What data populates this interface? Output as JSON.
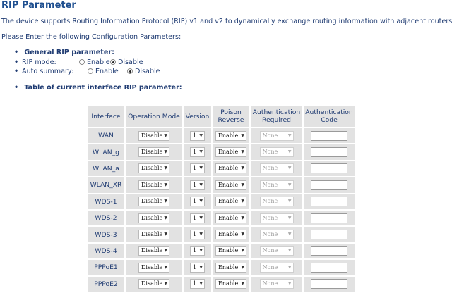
{
  "page": {
    "title": "RIP Parameter",
    "description": "The device supports Routing Information Protocol (RIP) v1 and v2 to dynamically exchange routing information with adjacent routers.",
    "instruction": "Please Enter the following Configuration Parameters:"
  },
  "general": {
    "heading": "General RIP parameter:",
    "rip_mode": {
      "label": "RIP mode:",
      "enable": "Enable",
      "disable": "Disable",
      "selected": "Disable"
    },
    "auto_summary": {
      "label": "Auto summary:",
      "enable": "Enable",
      "disable": "Disable",
      "selected": "Disable"
    }
  },
  "table_heading": "Table of current interface RIP parameter:",
  "table": {
    "headers": {
      "interface": "Interface",
      "operation_mode": "Operation Mode",
      "version": "Version",
      "poison_reverse_1": "Poison",
      "poison_reverse_2": "Reverse",
      "auth_required_1": "Authentication",
      "auth_required_2": "Required",
      "auth_code_1": "Authentication",
      "auth_code_2": "Code"
    },
    "rows": [
      {
        "interface": "WAN",
        "operation_mode": "Disable",
        "version": "1",
        "poison_reverse": "Enable",
        "auth_required": "None",
        "auth_code": ""
      },
      {
        "interface": "WLAN_g",
        "operation_mode": "Disable",
        "version": "1",
        "poison_reverse": "Enable",
        "auth_required": "None",
        "auth_code": ""
      },
      {
        "interface": "WLAN_a",
        "operation_mode": "Disable",
        "version": "1",
        "poison_reverse": "Enable",
        "auth_required": "None",
        "auth_code": ""
      },
      {
        "interface": "WLAN_XR",
        "operation_mode": "Disable",
        "version": "1",
        "poison_reverse": "Enable",
        "auth_required": "None",
        "auth_code": ""
      },
      {
        "interface": "WDS-1",
        "operation_mode": "Disable",
        "version": "1",
        "poison_reverse": "Enable",
        "auth_required": "None",
        "auth_code": ""
      },
      {
        "interface": "WDS-2",
        "operation_mode": "Disable",
        "version": "1",
        "poison_reverse": "Enable",
        "auth_required": "None",
        "auth_code": ""
      },
      {
        "interface": "WDS-3",
        "operation_mode": "Disable",
        "version": "1",
        "poison_reverse": "Enable",
        "auth_required": "None",
        "auth_code": ""
      },
      {
        "interface": "WDS-4",
        "operation_mode": "Disable",
        "version": "1",
        "poison_reverse": "Enable",
        "auth_required": "None",
        "auth_code": ""
      },
      {
        "interface": "PPPoE1",
        "operation_mode": "Disable",
        "version": "1",
        "poison_reverse": "Enable",
        "auth_required": "None",
        "auth_code": ""
      },
      {
        "interface": "PPPoE2",
        "operation_mode": "Disable",
        "version": "1",
        "poison_reverse": "Enable",
        "auth_required": "None",
        "auth_code": ""
      }
    ]
  },
  "icons": {
    "dropdown": "chevron-down-icon",
    "radio": "radio-icon"
  },
  "colors": {
    "text": "#1f3b72",
    "title": "#1d4e8f",
    "cell_bg": "#e2e2e2"
  }
}
